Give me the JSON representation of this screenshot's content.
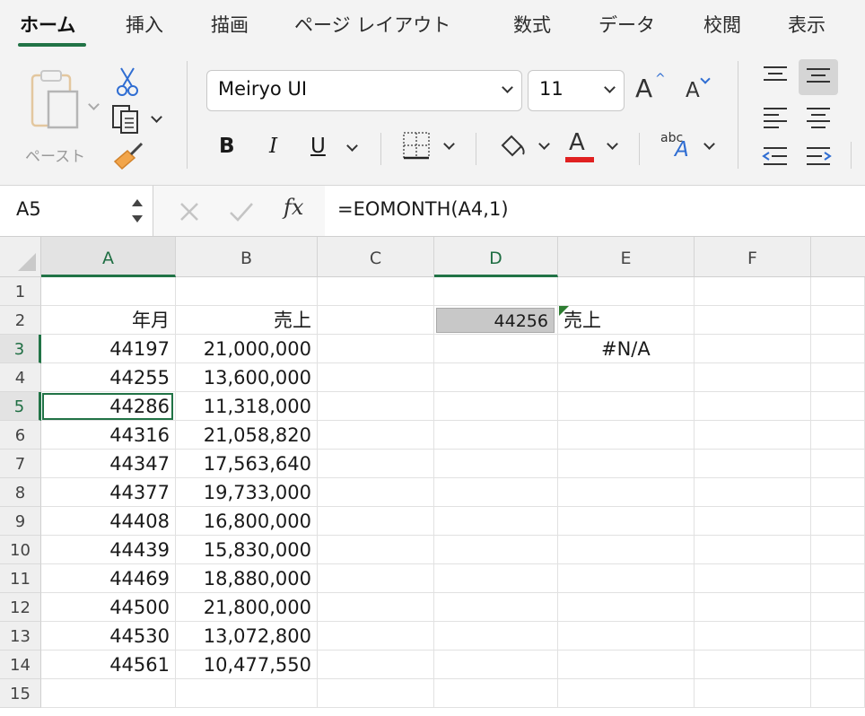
{
  "tabs": [
    "ホーム",
    "挿入",
    "描画",
    "ページ レイアウト",
    "数式",
    "データ",
    "校閲",
    "表示"
  ],
  "ribbon": {
    "paste_label": "ペースト",
    "font_name": "Meiryo UI",
    "font_size": "11",
    "bold_label": "B",
    "italic_label": "I",
    "underline_label": "U",
    "font_color_label": "A",
    "grow_font_label": "A",
    "shrink_font_label": "A",
    "orientation_abc": "abc",
    "orientation_a": "A",
    "accent_color": "#217346",
    "font_color": "#e02020"
  },
  "formula_bar": {
    "name_box": "A5",
    "fx_label": "fx",
    "formula": "=EOMONTH(A4,1)"
  },
  "sheet": {
    "columns": [
      "A",
      "B",
      "C",
      "D",
      "E",
      "F"
    ],
    "row_numbers": [
      "1",
      "2",
      "3",
      "4",
      "5",
      "6",
      "7",
      "8",
      "9",
      "10",
      "11",
      "12",
      "13",
      "14",
      "15"
    ],
    "header_a": "年月",
    "header_b": "売上",
    "rows": [
      {
        "a": "44197",
        "b": "21,000,000"
      },
      {
        "a": "44255",
        "b": "13,600,000"
      },
      {
        "a": "44286",
        "b": "11,318,000"
      },
      {
        "a": "44316",
        "b": "21,058,820"
      },
      {
        "a": "44347",
        "b": "17,563,640"
      },
      {
        "a": "44377",
        "b": "19,733,000"
      },
      {
        "a": "44408",
        "b": "16,800,000"
      },
      {
        "a": "44439",
        "b": "15,830,000"
      },
      {
        "a": "44469",
        "b": "18,880,000"
      },
      {
        "a": "44500",
        "b": "21,800,000"
      },
      {
        "a": "44530",
        "b": "13,072,800"
      },
      {
        "a": "44561",
        "b": "10,477,550"
      }
    ],
    "e2": "売上",
    "d3": "44256",
    "e3": "#N/A",
    "selected_cell": "A5"
  }
}
